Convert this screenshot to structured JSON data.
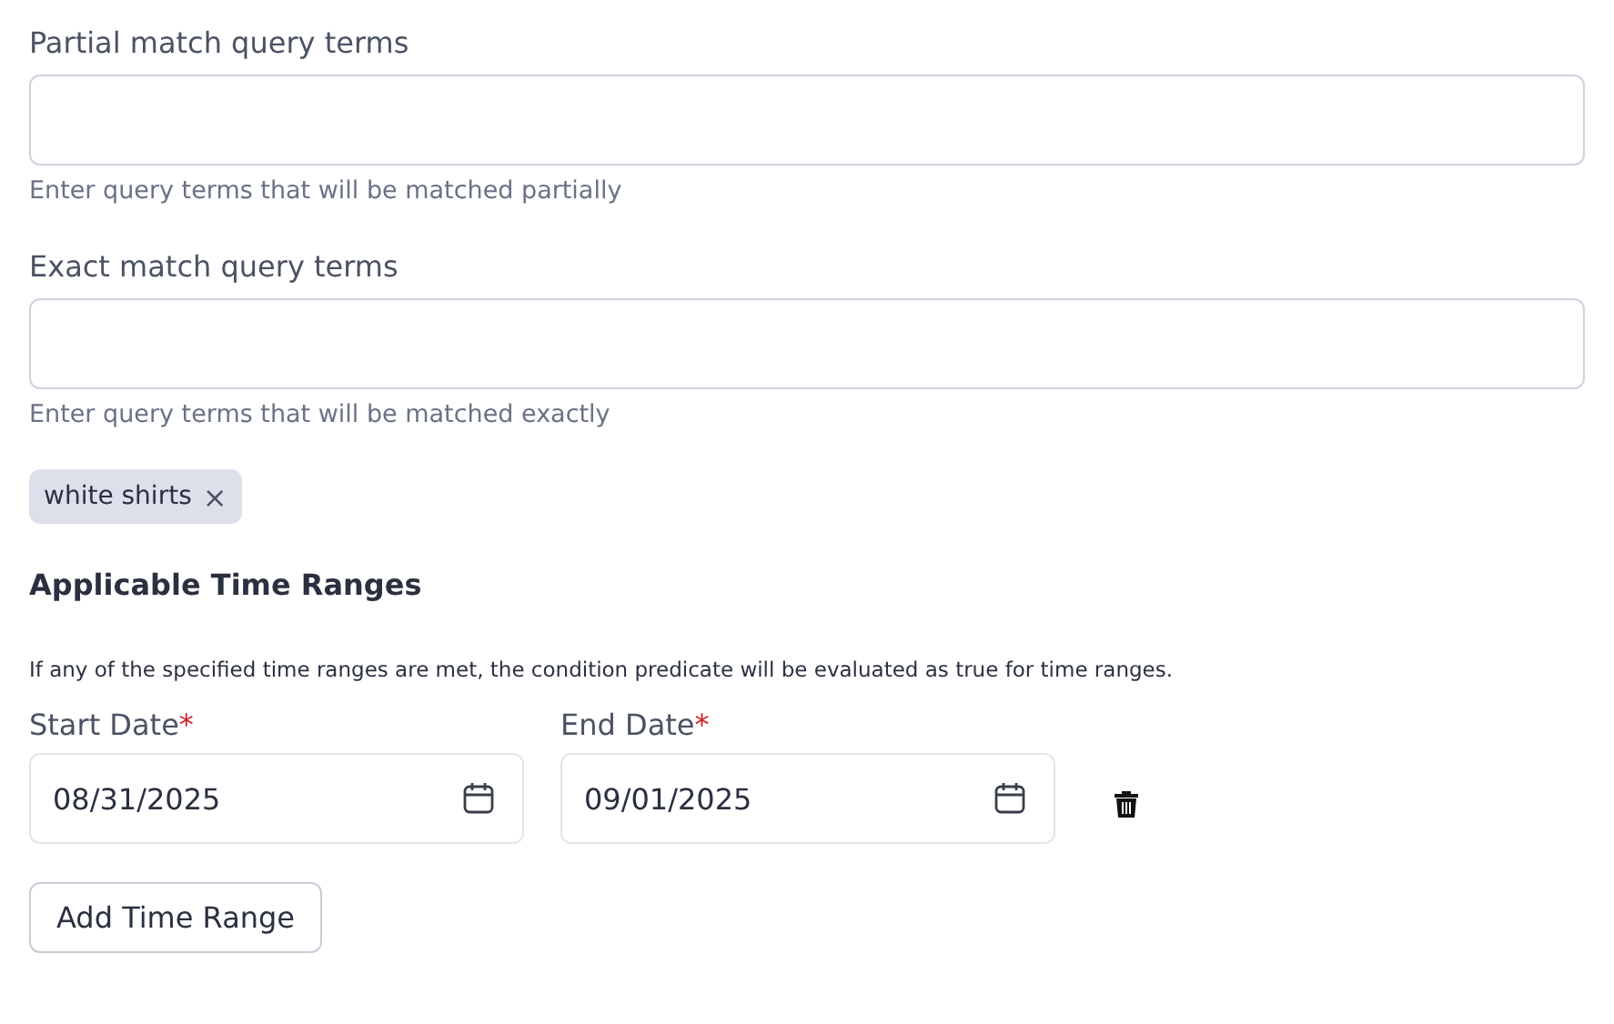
{
  "query_fields": [
    {
      "label": "Partial match query terms",
      "hint": "Enter query terms that will be matched partially"
    },
    {
      "label": "Exact match query terms",
      "hint": "Enter query terms that will be matched exactly"
    }
  ],
  "chips": [
    {
      "label": "white shirts",
      "remove": "×"
    }
  ],
  "time_ranges": {
    "heading": "Applicable Time Ranges",
    "description": "If any of the specified time ranges are met, the condition predicate will be evaluated as true for time ranges.",
    "ranges": [
      {
        "fields": [
          {
            "label": "Start Date",
            "required_mark": "*",
            "value": "08/31/2025"
          },
          {
            "label": "End Date",
            "required_mark": "*",
            "value": "09/01/2025"
          }
        ]
      }
    ],
    "add_button": "Add Time Range"
  }
}
